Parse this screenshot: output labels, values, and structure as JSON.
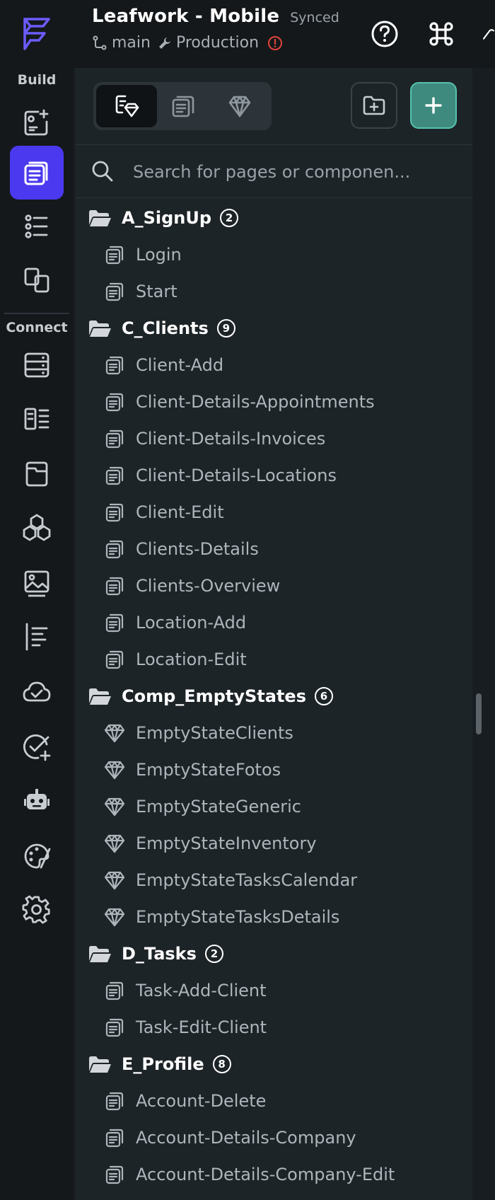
{
  "app": {
    "title": "Leafwork - Mobile",
    "sync_status": "Synced",
    "branch": "main",
    "environment": "Production"
  },
  "rail": {
    "build_label": "Build",
    "connect_label": "Connect"
  },
  "search": {
    "placeholder": "Search for pages or componen..."
  },
  "colors": {
    "accent": "#4b39ef",
    "add_button": "#3e8a7e",
    "warning": "#e0453a"
  },
  "tree": [
    {
      "folder": "A_SignUp",
      "count": "2",
      "items": [
        {
          "name": "Login",
          "icon": "page-icon"
        },
        {
          "name": "Start",
          "icon": "page-icon"
        }
      ]
    },
    {
      "folder": "C_Clients",
      "count": "9",
      "items": [
        {
          "name": "Client-Add",
          "icon": "page-icon"
        },
        {
          "name": "Client-Details-Appointments",
          "icon": "page-icon"
        },
        {
          "name": "Client-Details-Invoices",
          "icon": "page-icon"
        },
        {
          "name": "Client-Details-Locations",
          "icon": "page-icon"
        },
        {
          "name": "Client-Edit",
          "icon": "page-icon"
        },
        {
          "name": "Clients-Details",
          "icon": "page-icon"
        },
        {
          "name": "Clients-Overview",
          "icon": "page-icon"
        },
        {
          "name": "Location-Add",
          "icon": "page-icon"
        },
        {
          "name": "Location-Edit",
          "icon": "page-icon"
        }
      ]
    },
    {
      "folder": "Comp_EmptyStates",
      "count": "6",
      "items": [
        {
          "name": "EmptyStateClients",
          "icon": "component-icon"
        },
        {
          "name": "EmptyStateFotos",
          "icon": "component-icon"
        },
        {
          "name": "EmptyStateGeneric",
          "icon": "component-icon"
        },
        {
          "name": "EmptyStateInventory",
          "icon": "component-icon"
        },
        {
          "name": "EmptyStateTasksCalendar",
          "icon": "component-icon"
        },
        {
          "name": "EmptyStateTasksDetails",
          "icon": "component-icon"
        }
      ]
    },
    {
      "folder": "D_Tasks",
      "count": "2",
      "items": [
        {
          "name": "Task-Add-Client",
          "icon": "page-icon"
        },
        {
          "name": "Task-Edit-Client",
          "icon": "page-icon"
        }
      ]
    },
    {
      "folder": "E_Profile",
      "count": "8",
      "items": [
        {
          "name": "Account-Delete",
          "icon": "page-icon"
        },
        {
          "name": "Account-Details-Company",
          "icon": "page-icon"
        },
        {
          "name": "Account-Details-Company-Edit",
          "icon": "page-icon"
        }
      ]
    }
  ]
}
